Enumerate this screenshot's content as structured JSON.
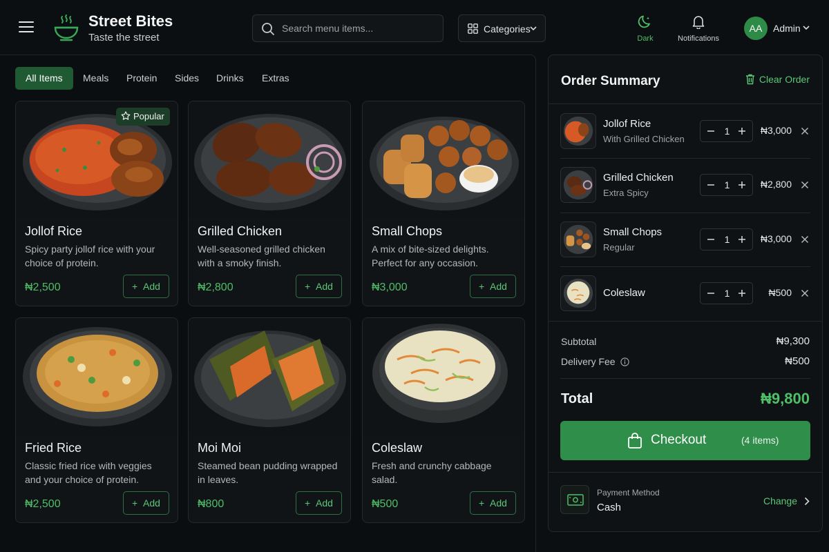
{
  "header": {
    "brand_title": "Street Bites",
    "brand_subtitle": "Taste the street",
    "search_placeholder": "Search menu items...",
    "categories_label": "Categories",
    "theme_label": "Dark",
    "notifications_label": "Notifications",
    "avatar_initials": "AA",
    "user_name": "Admin"
  },
  "tabs": [
    "All Items",
    "Meals",
    "Protein",
    "Sides",
    "Drinks",
    "Extras"
  ],
  "active_tab": "All Items",
  "popular_badge": "Popular",
  "add_label": "Add",
  "menu_items": [
    {
      "name": "Jollof Rice",
      "description": "Spicy party jollof rice with your choice of protein.",
      "price": "₦2,500",
      "icon": "jollof-rice-plate"
    },
    {
      "name": "Grilled Chicken",
      "description": "Well-seasoned grilled chicken with a smoky finish.",
      "price": "₦2,800",
      "icon": "grilled-chicken-plate"
    },
    {
      "name": "Small Chops",
      "description": "A mix of bite-sized delights. Perfect for any occasion.",
      "price": "₦3,000",
      "icon": "small-chops-plate"
    },
    {
      "name": "Fried Rice",
      "description": "Classic fried rice with veggies and your choice of protein.",
      "price": "₦2,500",
      "icon": "fried-rice-plate"
    },
    {
      "name": "Moi Moi",
      "description": "Steamed bean pudding wrapped in leaves.",
      "price": "₦800",
      "icon": "moi-moi-plate"
    },
    {
      "name": "Coleslaw",
      "description": "Fresh and crunchy cabbage salad.",
      "price": "₦500",
      "icon": "coleslaw-bowl"
    }
  ],
  "order": {
    "title": "Order Summary",
    "clear_label": "Clear Order",
    "items": [
      {
        "name": "Jollof Rice",
        "variant": "With Grilled Chicken",
        "qty": "1",
        "price": "₦3,000"
      },
      {
        "name": "Grilled Chicken",
        "variant": "Extra Spicy",
        "qty": "1",
        "price": "₦2,800"
      },
      {
        "name": "Small Chops",
        "variant": "Regular",
        "qty": "1",
        "price": "₦3,000"
      },
      {
        "name": "Coleslaw",
        "variant": "",
        "qty": "1",
        "price": "₦500"
      }
    ],
    "subtotal_label": "Subtotal",
    "subtotal": "₦9,300",
    "delivery_label": "Delivery Fee",
    "delivery": "₦500",
    "total_label": "Total",
    "total": "₦9,800",
    "checkout_label": "Checkout",
    "checkout_count": "(4 items)",
    "payment_label": "Payment Method",
    "payment_value": "Cash",
    "change_label": "Change"
  },
  "colors": {
    "accent": "#4fbf68",
    "accent_dark": "#2f8f4a",
    "background": "#0c0f11"
  }
}
